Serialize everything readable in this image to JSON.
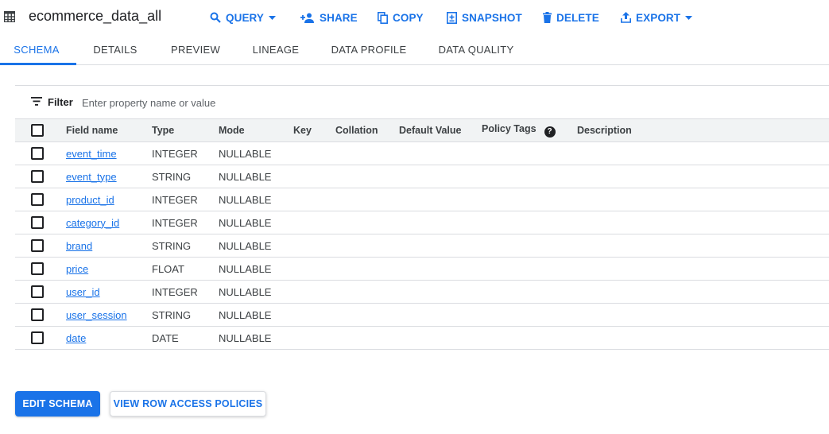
{
  "header": {
    "title": "ecommerce_data_all",
    "actions": {
      "query": "QUERY",
      "share": "SHARE",
      "copy": "COPY",
      "snapshot": "SNAPSHOT",
      "delete": "DELETE",
      "export": "EXPORT"
    }
  },
  "tabs": [
    "SCHEMA",
    "DETAILS",
    "PREVIEW",
    "LINEAGE",
    "DATA PROFILE",
    "DATA QUALITY"
  ],
  "active_tab": "SCHEMA",
  "filter": {
    "label": "Filter",
    "placeholder": "Enter property name or value"
  },
  "table": {
    "columns": [
      "Field name",
      "Type",
      "Mode",
      "Key",
      "Collation",
      "Default Value",
      "Policy Tags",
      "Description"
    ],
    "rows": [
      {
        "name": "event_time",
        "type": "INTEGER",
        "mode": "NULLABLE"
      },
      {
        "name": "event_type",
        "type": "STRING",
        "mode": "NULLABLE"
      },
      {
        "name": "product_id",
        "type": "INTEGER",
        "mode": "NULLABLE"
      },
      {
        "name": "category_id",
        "type": "INTEGER",
        "mode": "NULLABLE"
      },
      {
        "name": "brand",
        "type": "STRING",
        "mode": "NULLABLE"
      },
      {
        "name": "price",
        "type": "FLOAT",
        "mode": "NULLABLE"
      },
      {
        "name": "user_id",
        "type": "INTEGER",
        "mode": "NULLABLE"
      },
      {
        "name": "user_session",
        "type": "STRING",
        "mode": "NULLABLE"
      },
      {
        "name": "date",
        "type": "DATE",
        "mode": "NULLABLE"
      }
    ]
  },
  "buttons": {
    "edit_schema": "EDIT SCHEMA",
    "view_row_access": "VIEW ROW ACCESS POLICIES"
  },
  "colors": {
    "accent": "#1a73e8",
    "text": "#202124",
    "divider": "#dadce0",
    "header_bg": "#f1f3f4"
  }
}
